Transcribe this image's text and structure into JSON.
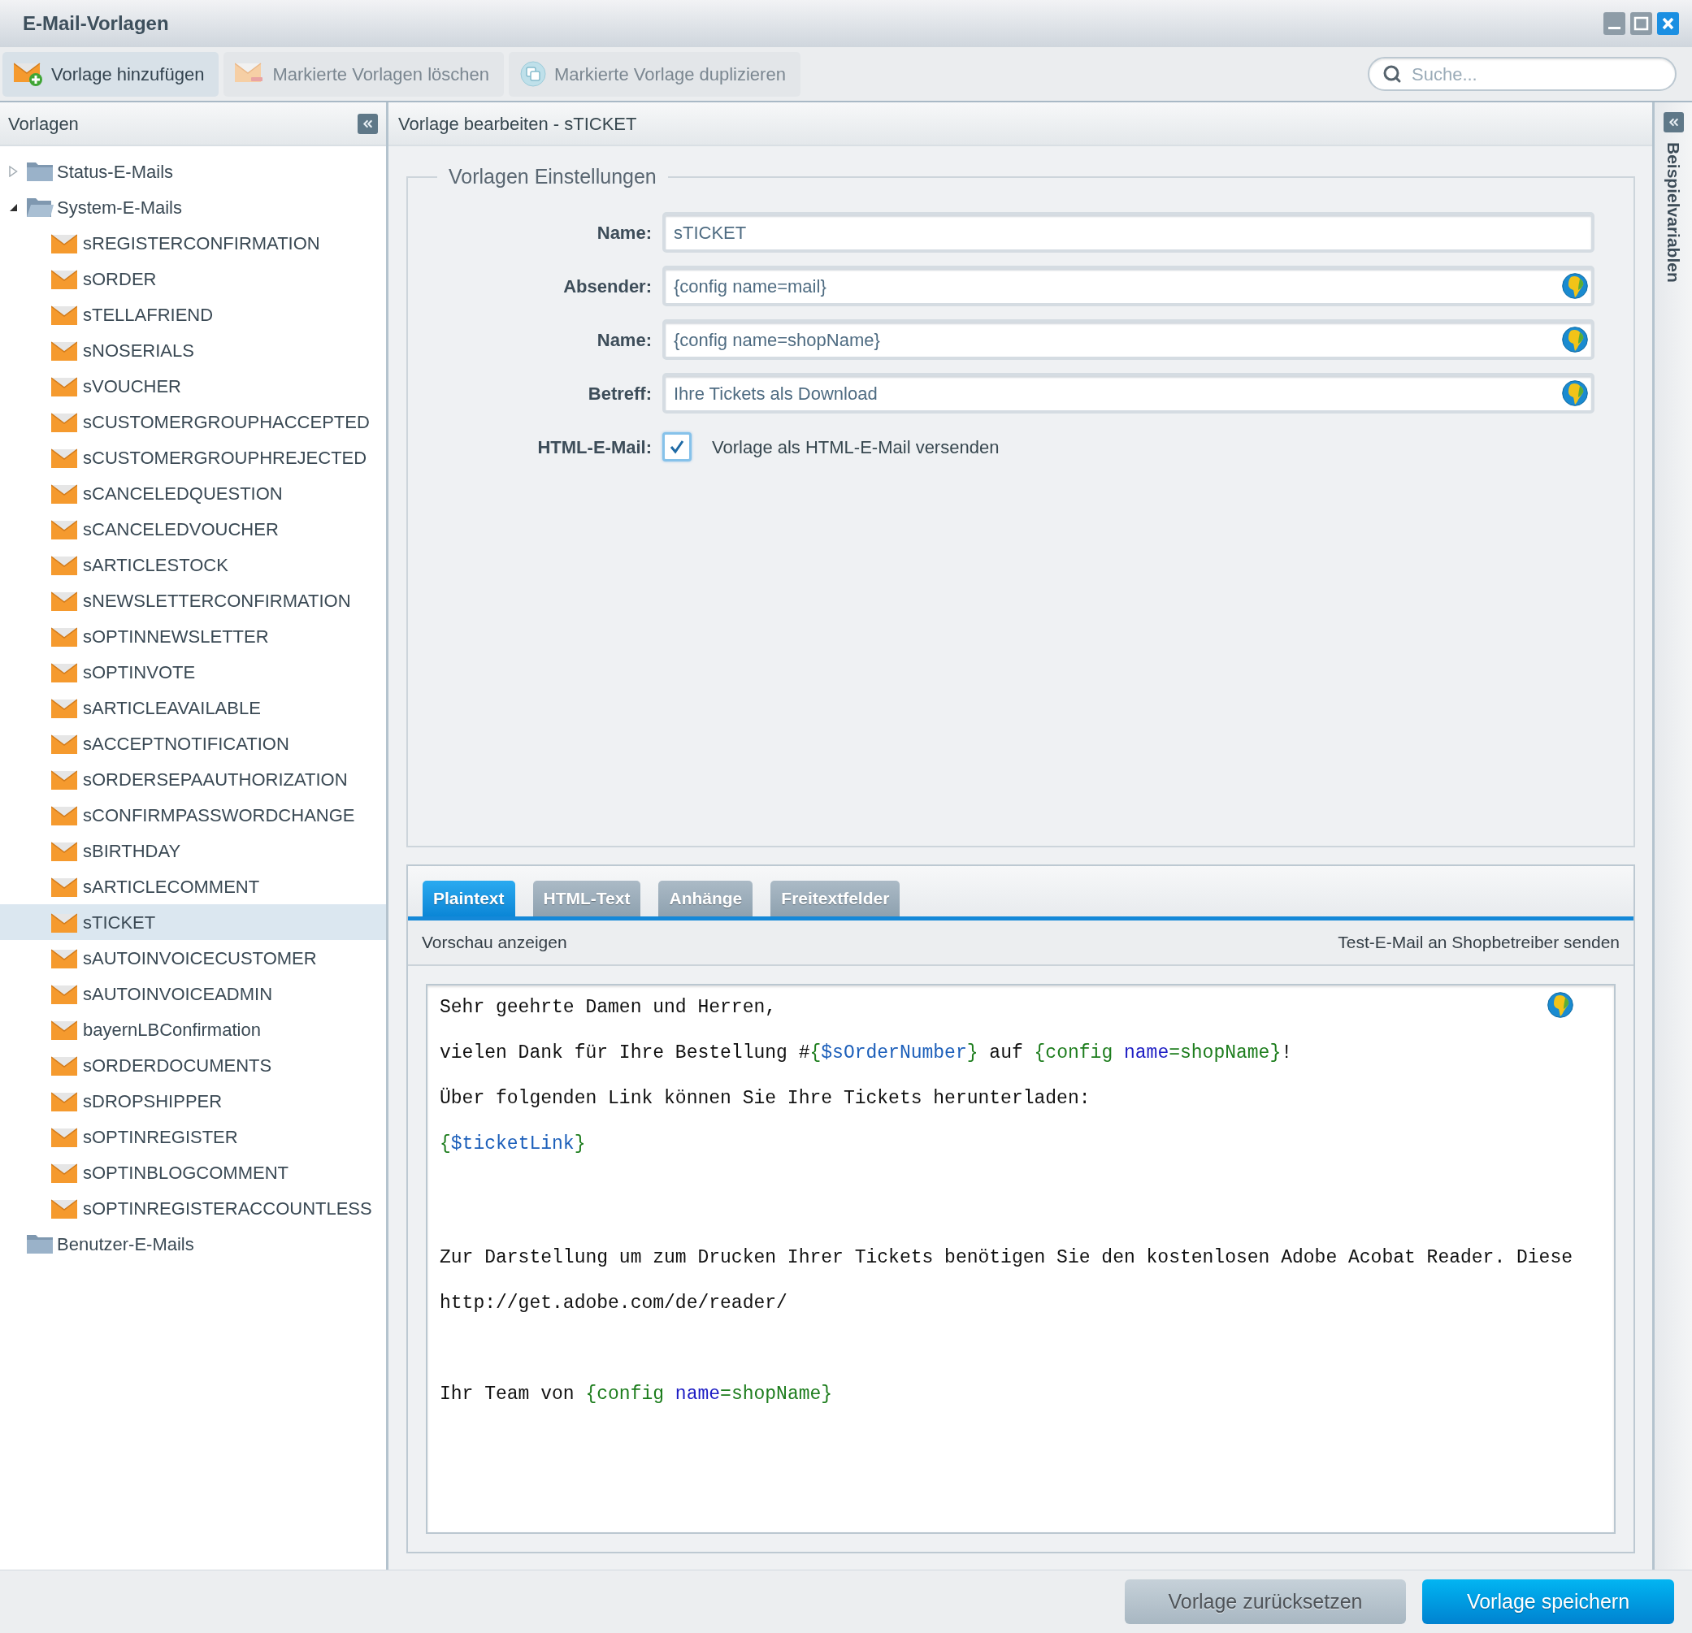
{
  "window": {
    "title": "E-Mail-Vorlagen"
  },
  "toolbar": {
    "buttons": [
      {
        "kind": "add",
        "label": "Vorlage hinzufügen",
        "disabled": false
      },
      {
        "kind": "delete",
        "label": "Markierte Vorlagen löschen",
        "disabled": true
      },
      {
        "kind": "duplicate",
        "label": "Markierte Vorlage duplizieren",
        "disabled": true
      }
    ],
    "search": {
      "placeholder": "Suche..."
    }
  },
  "sidebar": {
    "title": "Vorlagen",
    "tree": [
      {
        "label": "Status-E-Mails",
        "expandable": true,
        "expanded": false
      },
      {
        "label": "System-E-Mails",
        "expandable": true,
        "expanded": true,
        "children": [
          {
            "label": "sREGISTERCONFIRMATION",
            "selected": false
          },
          {
            "label": "sORDER",
            "selected": false
          },
          {
            "label": "sTELLAFRIEND",
            "selected": false
          },
          {
            "label": "sNOSERIALS",
            "selected": false
          },
          {
            "label": "sVOUCHER",
            "selected": false
          },
          {
            "label": "sCUSTOMERGROUPHACCEPTED",
            "selected": false
          },
          {
            "label": "sCUSTOMERGROUPHREJECTED",
            "selected": false
          },
          {
            "label": "sCANCELEDQUESTION",
            "selected": false
          },
          {
            "label": "sCANCELEDVOUCHER",
            "selected": false
          },
          {
            "label": "sARTICLESTOCK",
            "selected": false
          },
          {
            "label": "sNEWSLETTERCONFIRMATION",
            "selected": false
          },
          {
            "label": "sOPTINNEWSLETTER",
            "selected": false
          },
          {
            "label": "sOPTINVOTE",
            "selected": false
          },
          {
            "label": "sARTICLEAVAILABLE",
            "selected": false
          },
          {
            "label": "sACCEPTNOTIFICATION",
            "selected": false
          },
          {
            "label": "sORDERSEPAAUTHORIZATION",
            "selected": false
          },
          {
            "label": "sCONFIRMPASSWORDCHANGE",
            "selected": false
          },
          {
            "label": "sBIRTHDAY",
            "selected": false
          },
          {
            "label": "sARTICLECOMMENT",
            "selected": false
          },
          {
            "label": "sTICKET",
            "selected": true
          },
          {
            "label": "sAUTOINVOICECUSTOMER",
            "selected": false
          },
          {
            "label": "sAUTOINVOICEADMIN",
            "selected": false
          },
          {
            "label": "bayernLBConfirmation",
            "selected": false
          },
          {
            "label": "sORDERDOCUMENTS",
            "selected": false
          },
          {
            "label": "sDROPSHIPPER",
            "selected": false
          },
          {
            "label": "sOPTINREGISTER",
            "selected": false
          },
          {
            "label": "sOPTINBLOGCOMMENT",
            "selected": false
          },
          {
            "label": "sOPTINREGISTERACCOUNTLESS",
            "selected": false
          }
        ]
      },
      {
        "label": "Benutzer-E-Mails",
        "expandable": false,
        "expanded": false
      }
    ]
  },
  "editor": {
    "title": "Vorlage bearbeiten - sTICKET",
    "settings": {
      "legend": "Vorlagen Einstellungen",
      "fields": [
        {
          "label": "Name:",
          "value": "sTICKET",
          "translatable": false
        },
        {
          "label": "Absender:",
          "value": "{config name=mail}",
          "translatable": true
        },
        {
          "label": "Name:",
          "value": "{config name=shopName}",
          "translatable": true
        },
        {
          "label": "Betreff:",
          "value": "Ihre Tickets als Download",
          "translatable": true
        }
      ],
      "html_mail": {
        "label": "HTML-E-Mail:",
        "checked": true,
        "text": "Vorlage als HTML-E-Mail versenden"
      }
    },
    "tabs": [
      {
        "label": "Plaintext",
        "selected": true
      },
      {
        "label": "HTML-Text",
        "selected": false
      },
      {
        "label": "Anhänge",
        "selected": false
      },
      {
        "label": "Freitextfelder",
        "selected": false
      }
    ],
    "content_toolbar": {
      "preview": "Vorschau anzeigen",
      "test_mail": "Test-E-Mail an Shopbetreiber senden"
    },
    "code": {
      "translatable": true,
      "lines": [
        {
          "kind": "text",
          "segments": [
            {
              "kind": "plain",
              "text": "Sehr geehrte Damen und Herren,"
            }
          ]
        },
        {
          "kind": "blank"
        },
        {
          "kind": "text",
          "segments": [
            {
              "kind": "plain",
              "text": "vielen Dank für Ihre Bestellung #"
            },
            {
              "kind": "tag",
              "text": "{"
            },
            {
              "kind": "variable",
              "text": "$sOrderNumber"
            },
            {
              "kind": "tag",
              "text": "}"
            },
            {
              "kind": "plain",
              "text": " auf "
            },
            {
              "kind": "tag",
              "text": "{config "
            },
            {
              "kind": "attribute",
              "text": "name"
            },
            {
              "kind": "tag",
              "text": "=shopName}"
            },
            {
              "kind": "plain",
              "text": "!"
            }
          ]
        },
        {
          "kind": "blank"
        },
        {
          "kind": "text",
          "segments": [
            {
              "kind": "plain",
              "text": "Über folgenden Link können Sie Ihre Tickets herunterladen:"
            }
          ]
        },
        {
          "kind": "blank"
        },
        {
          "kind": "text",
          "segments": [
            {
              "kind": "tag",
              "text": "{"
            },
            {
              "kind": "variable",
              "text": "$ticketLink"
            },
            {
              "kind": "tag",
              "text": "}"
            }
          ]
        },
        {
          "kind": "blank"
        },
        {
          "kind": "blank"
        },
        {
          "kind": "blank"
        },
        {
          "kind": "blank"
        },
        {
          "kind": "text",
          "segments": [
            {
              "kind": "plain",
              "text": "Zur Darstellung um zum Drucken Ihrer Tickets benötigen Sie den kostenlosen Adobe Acobat Reader. Diese"
            }
          ]
        },
        {
          "kind": "blank"
        },
        {
          "kind": "text",
          "segments": [
            {
              "kind": "plain",
              "text": "http://get.adobe.com/de/reader/"
            }
          ]
        },
        {
          "kind": "blank"
        },
        {
          "kind": "blank"
        },
        {
          "kind": "blank"
        },
        {
          "kind": "text",
          "segments": [
            {
              "kind": "plain",
              "text": "Ihr Team von "
            },
            {
              "kind": "tag",
              "text": "{config "
            },
            {
              "kind": "attribute",
              "text": "name"
            },
            {
              "kind": "tag",
              "text": "=shopName}"
            }
          ]
        }
      ]
    }
  },
  "side_panel": {
    "title": "Beispielvariablen"
  },
  "footer": {
    "buttons": [
      {
        "kind": "secondary",
        "label": "Vorlage zurücksetzen"
      },
      {
        "kind": "primary",
        "label": "Vorlage speichern"
      }
    ]
  }
}
